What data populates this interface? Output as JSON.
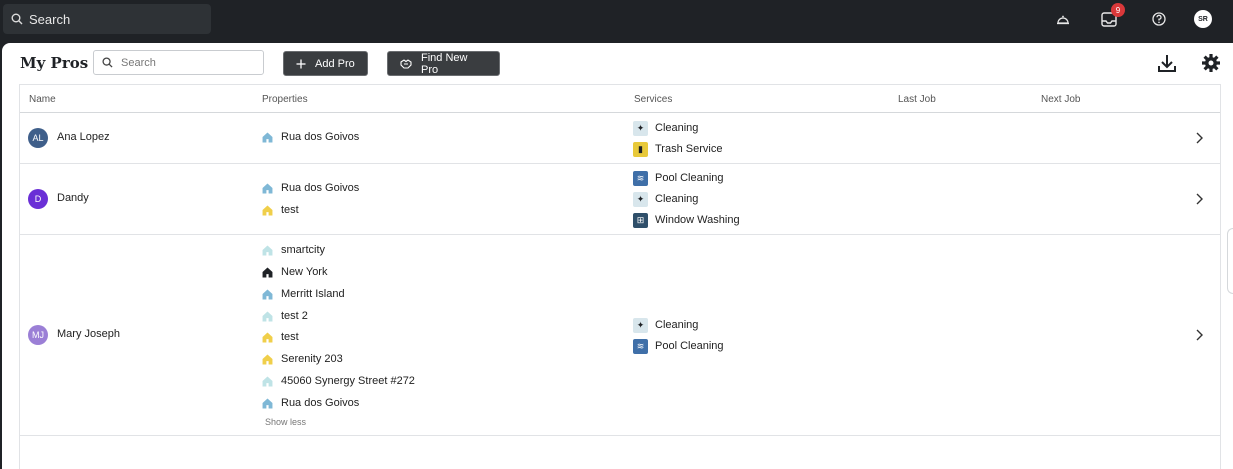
{
  "topbar": {
    "search_placeholder": "Search",
    "notification_count": "9",
    "user_initials": "SR"
  },
  "header": {
    "title": "My Pros",
    "search_placeholder": "Search",
    "add_pro_label": "Add Pro",
    "find_new_pro_label": "Find New Pro"
  },
  "columns": {
    "name": "Name",
    "properties": "Properties",
    "services": "Services",
    "last_job": "Last Job",
    "next_job": "Next Job"
  },
  "rows": [
    {
      "initials": "AL",
      "avatar_color": "#3f5f8a",
      "name": "Ana Lopez",
      "properties": [
        {
          "label": "Rua dos Goivos",
          "color": "#7fb8d6"
        }
      ],
      "services": [
        {
          "label": "Cleaning",
          "icon": "cleaning-icon"
        },
        {
          "label": "Trash Service",
          "icon": "trash-service-icon"
        }
      ]
    },
    {
      "initials": "D",
      "avatar_color": "#6a2fd6",
      "name": "Dandy",
      "properties": [
        {
          "label": "Rua dos Goivos",
          "color": "#7fb8d6"
        },
        {
          "label": "test",
          "color": "#f0cf4a"
        }
      ],
      "services": [
        {
          "label": "Pool Cleaning",
          "icon": "pool-cleaning-icon"
        },
        {
          "label": "Cleaning",
          "icon": "cleaning-icon"
        },
        {
          "label": "Window Washing",
          "icon": "window-washing-icon"
        }
      ]
    },
    {
      "initials": "MJ",
      "avatar_color": "#9b7fd6",
      "name": "Mary Joseph",
      "properties": [
        {
          "label": "smartcity",
          "color": "#bfe3e6"
        },
        {
          "label": "New York",
          "color": "#1f2226"
        },
        {
          "label": "Merritt Island",
          "color": "#7fb8d6"
        },
        {
          "label": "test 2",
          "color": "#bfe3e6"
        },
        {
          "label": "test",
          "color": "#f0cf4a"
        },
        {
          "label": "Serenity 203",
          "color": "#f0cf4a"
        },
        {
          "label": "45060 Synergy Street #272",
          "color": "#bfe3e6"
        },
        {
          "label": "Rua dos Goivos",
          "color": "#7fb8d6"
        }
      ],
      "show_less": "Show less",
      "services": [
        {
          "label": "Cleaning",
          "icon": "cleaning-icon"
        },
        {
          "label": "Pool Cleaning",
          "icon": "pool-cleaning-icon"
        }
      ]
    }
  ]
}
